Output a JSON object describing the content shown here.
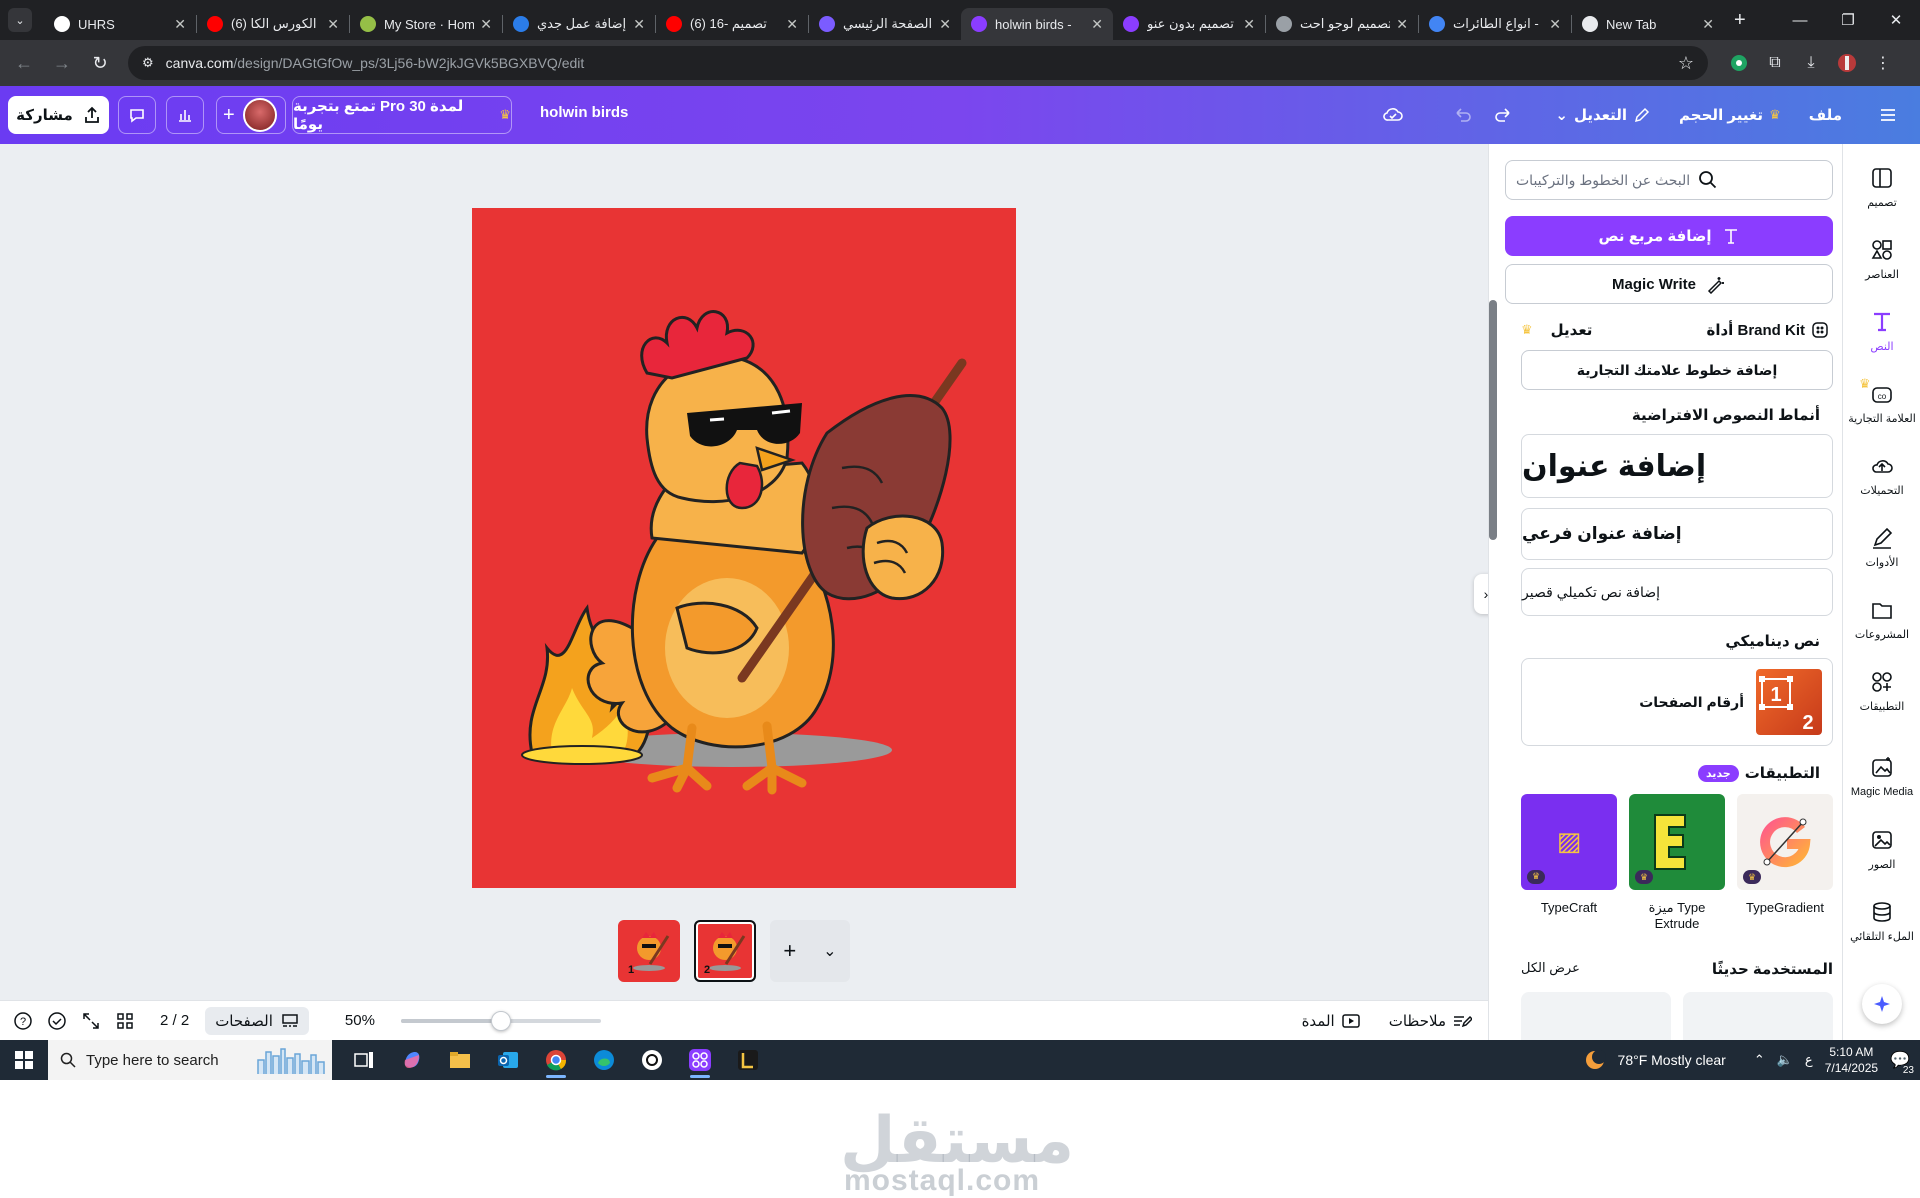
{
  "browser": {
    "tabs": [
      {
        "title": "UHRS",
        "color": "#ffffff",
        "active": false
      },
      {
        "title": "(6) الكورس الكا",
        "color": "#ff0000",
        "active": false
      },
      {
        "title": "My Store · Hom",
        "color": "#95bf47",
        "active": false
      },
      {
        "title": "إضافة عمل جدي",
        "color": "#2b7de9",
        "active": false
      },
      {
        "title": "(6) 16- تصميم",
        "color": "#ff0000",
        "active": false
      },
      {
        "title": "الصفحة الرئيسي",
        "color": "#7b5cff",
        "active": false
      },
      {
        "title": "holwin birds -",
        "color": "#8b3dff",
        "active": true
      },
      {
        "title": "تصميم بدون عنو",
        "color": "#8b3dff",
        "active": false
      },
      {
        "title": "تصميم لوجو احت",
        "color": "#9aa0a6",
        "active": false
      },
      {
        "title": "انواع الطائرات -",
        "color": "#4285f4",
        "active": false
      },
      {
        "title": "New Tab",
        "color": "#e8eaed",
        "active": false
      }
    ],
    "url_host": "canva.com",
    "url_path": "/design/DAGtGfOw_ps/3Lj56-bW2jkJGVk5BGXBVQ/edit"
  },
  "header": {
    "share_label": "مشاركة",
    "pro_trial_label": "تمتع بتجربة Pro لمدة 30 يومًا",
    "design_title": "holwin birds",
    "edit_label": "التعديل",
    "resize_label": "تغيير الحجم",
    "file_label": "ملف"
  },
  "canvas": {
    "background": "#e83434",
    "page_thumbs": [
      {
        "num": "1",
        "active": false
      },
      {
        "num": "2",
        "active": true
      }
    ]
  },
  "bottom_bar": {
    "page_count": "2 / 2",
    "pages_label": "الصفحات",
    "zoom": "50%",
    "zoom_fraction": 0.5,
    "duration_label": "المدة",
    "notes_label": "ملاحظات"
  },
  "panel": {
    "search_placeholder": "البحث عن الخطوط والتركيبات",
    "add_textbox_label": "إضافة مربع نص",
    "magic_write_label": "Magic Write",
    "brand_kit_label": "أداة Brand Kit",
    "brand_edit_label": "تعديل",
    "add_brand_fonts_label": "إضافة خطوط علامتك التجارية",
    "default_styles_title": "أنماط النصوص الافتراضية",
    "heading_label": "إضافة عنوان",
    "subheading_label": "إضافة عنوان فرعي",
    "body_label": "إضافة نص تكميلي قصير",
    "dynamic_title": "نص ديناميكي",
    "page_numbers_label": "أرقام الصفحات",
    "apps_title": "التطبيقات",
    "new_badge": "جديد",
    "apps": [
      {
        "name": "TypeGradient",
        "bg": "#f4f1ee"
      },
      {
        "name": "ميزة Type Extrude",
        "bg": "#1f8b3a"
      },
      {
        "name": "TypeCraft",
        "bg": "#7a2ff0"
      }
    ],
    "recent_title": "المستخدمة حديثًا",
    "see_all_label": "عرض الكل"
  },
  "rail": [
    {
      "label": "تصميم",
      "icon": "layout-icon"
    },
    {
      "label": "العناصر",
      "icon": "elements-icon"
    },
    {
      "label": "النص",
      "icon": "text-icon",
      "active": true
    },
    {
      "label": "العلامة التجارية",
      "icon": "brand-icon"
    },
    {
      "label": "التحميلات",
      "icon": "upload-icon"
    },
    {
      "label": "الأدوات",
      "icon": "draw-icon"
    },
    {
      "label": "المشروعات",
      "icon": "folder-icon"
    },
    {
      "label": "التطبيقات",
      "icon": "apps-icon"
    },
    {
      "label": "Magic Media",
      "icon": "magic-media-icon"
    },
    {
      "label": "الصور",
      "icon": "photos-icon"
    },
    {
      "label": "الملء التلقائي",
      "icon": "autofill-icon"
    }
  ],
  "watermark": {
    "ar": "مستقل",
    "en": "mostaql.com"
  },
  "taskbar": {
    "search_placeholder": "Type here to search",
    "weather": "78°F  Mostly clear",
    "lang": "ع",
    "time": "5:10 AM",
    "date": "7/14/2025",
    "notif_count": "23"
  }
}
